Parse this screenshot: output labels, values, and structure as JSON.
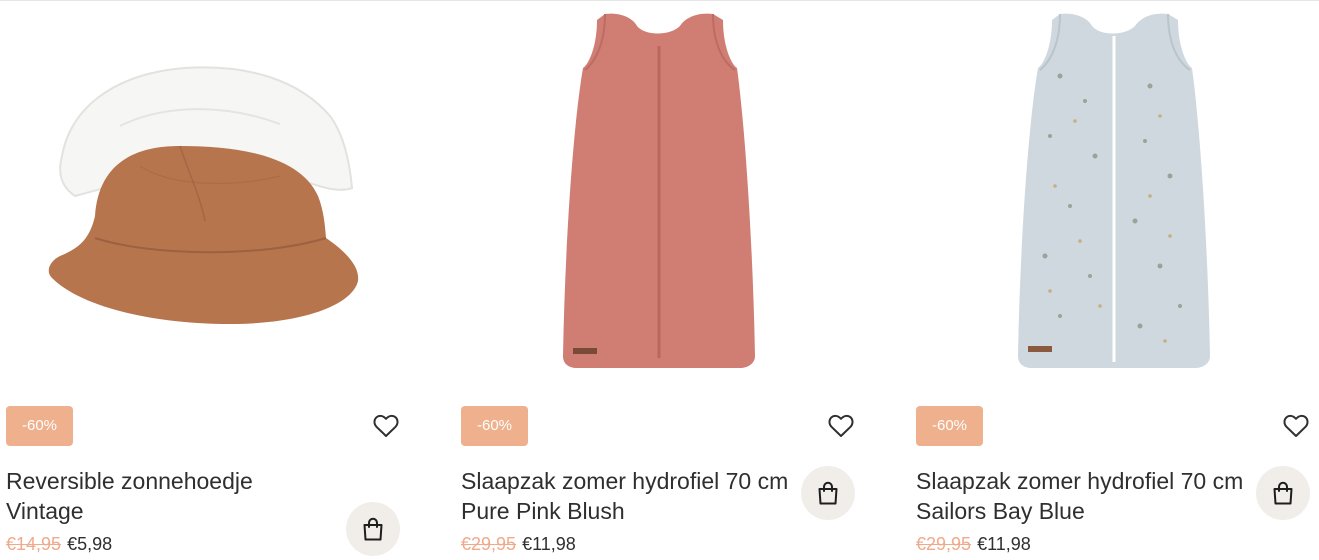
{
  "products": [
    {
      "badge": "-60%",
      "title": "Reversible zonnehoedje Vintage",
      "old_price": "€14,95",
      "price": "€5,98",
      "image_icon": "bucket-hat-image"
    },
    {
      "badge": "-60%",
      "title": "Slaapzak zomer hydrofiel 70 cm Pure Pink Blush",
      "old_price": "€29,95",
      "price": "€11,98",
      "image_icon": "sleeping-bag-pink-image"
    },
    {
      "badge": "-60%",
      "title": "Slaapzak zomer hydrofiel 70 cm Sailors Bay Blue",
      "old_price": "€29,95",
      "price": "€11,98",
      "image_icon": "sleeping-bag-blue-image"
    }
  ],
  "colors": {
    "badge": "#eeb08d",
    "old_price": "#f0a98a",
    "cart_button_bg": "#f1eeea",
    "text": "#2f2f2f"
  },
  "icons": {
    "wishlist": "heart-icon",
    "cart": "shopping-bag-icon"
  }
}
